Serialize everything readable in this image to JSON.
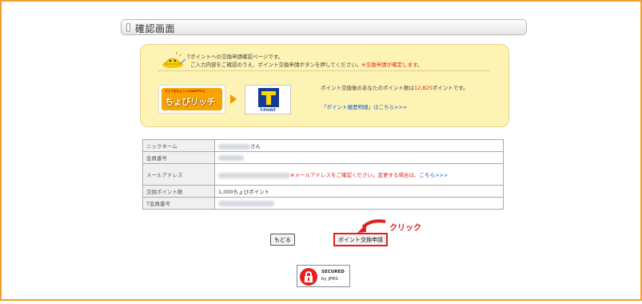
{
  "header": {
    "title": "確認画面"
  },
  "intro": {
    "line1": "Tポイントへの交換申請確認ページです。",
    "line2": "ご入力内容をご確認のうえ、ポイント交換申請ボタンを押してください。",
    "warning": "※交換申請が確定します。"
  },
  "exchange": {
    "from_logo_tagline": "ライフをちょこっとHAPPY!に",
    "from_logo_name": "ちょびリッチ",
    "to_logo_name": "T-POINT",
    "points_prefix": "ポイント交換後のあなたのポイント数は",
    "points_value": "12,825",
    "points_suffix": "ポイントです。",
    "history_link": "「ポイント履歴明細」はこちら>>>"
  },
  "details": {
    "rows": [
      {
        "label": "ニックネーム",
        "suffix": "さん"
      },
      {
        "label": "会員番号"
      },
      {
        "label": "メールアドレス",
        "note": "※メールアドレスをご確認ください。変更する場合は、",
        "link": "こちら>>>"
      },
      {
        "label": "交換ポイント数",
        "value": "1,000ちょびポイント"
      },
      {
        "label": "T会員番号"
      }
    ]
  },
  "actions": {
    "back_label": "もどる",
    "apply_label": "ポイント交換申請",
    "annotation": "クリック"
  },
  "seal": {
    "line1": "SECURED",
    "line2": "by JPRS"
  },
  "colors": {
    "accent": "#f0a030",
    "warning": "#e02020",
    "link": "#1a5fc8",
    "info_bg": "#fdf3b4"
  }
}
